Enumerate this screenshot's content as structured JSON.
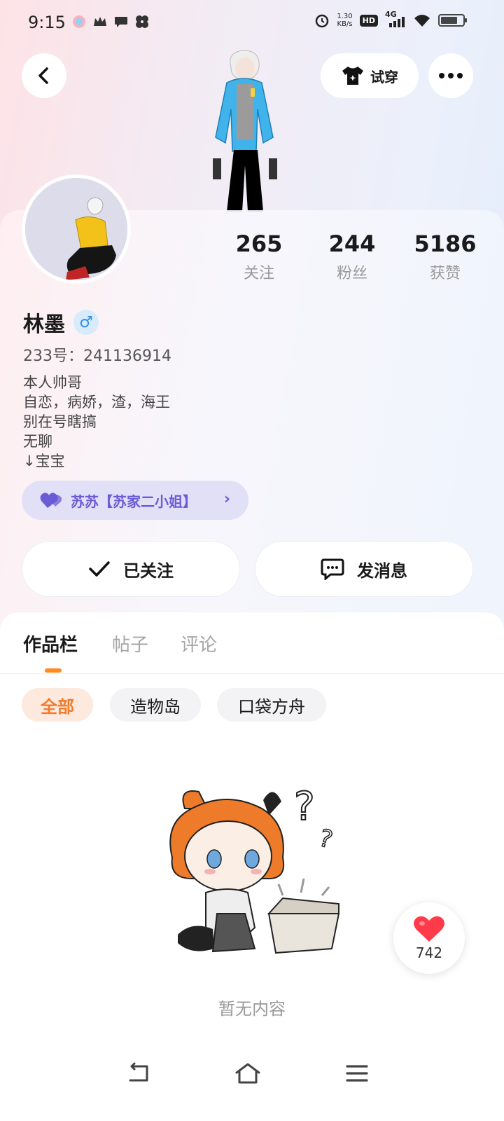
{
  "status_bar": {
    "time": "9:15",
    "net_speed_value": "1.30",
    "net_speed_unit": "KB/s",
    "hd": "HD",
    "network": "4G",
    "battery_level": 0.75
  },
  "header": {
    "tryon_label": "试穿"
  },
  "profile": {
    "name": "林墨",
    "gender_symbol": "♂",
    "uid": "233号：241136914",
    "bio": [
      "本人帅哥",
      "自恋，病娇，渣，海王",
      "别在号瞎搞",
      "无聊",
      "↓宝宝"
    ],
    "cp_label": "苏苏【苏家二小姐】",
    "cp_arrow": "›"
  },
  "stats": [
    {
      "value": "265",
      "label": "关注"
    },
    {
      "value": "244",
      "label": "粉丝"
    },
    {
      "value": "5186",
      "label": "获赞"
    }
  ],
  "actions": {
    "follow_label": "已关注",
    "message_label": "发消息"
  },
  "tabs": [
    "作品栏",
    "帖子",
    "评论"
  ],
  "filters": [
    "全部",
    "造物岛",
    "口袋方舟"
  ],
  "empty_text": "暂无内容",
  "like_count": "742",
  "colors": {
    "accent_orange": "#ff8a1f",
    "cp_purple": "#6a5bd6",
    "like_red": "#ff3b4a"
  }
}
